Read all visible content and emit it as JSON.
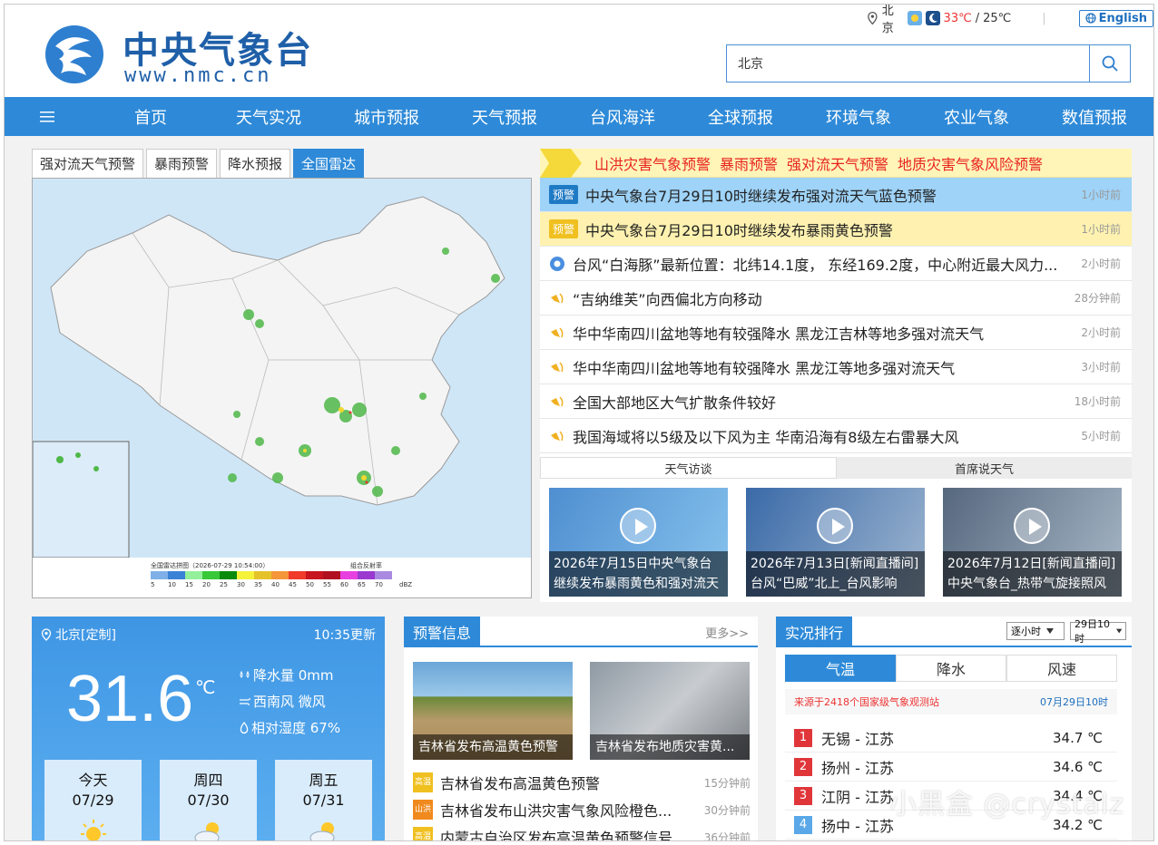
{
  "header": {
    "logo_cn": "中央气象台",
    "logo_en": "www.nmc.cn",
    "city": "北京",
    "temp_high": "33℃",
    "temp_sep": " / ",
    "temp_low": "25℃",
    "english_label": "English",
    "search_value": "北京"
  },
  "nav": {
    "items": [
      "首页",
      "天气实况",
      "城市预报",
      "天气预报",
      "台风海洋",
      "全球预报",
      "环境气象",
      "农业气象",
      "数值预报"
    ]
  },
  "radar": {
    "tabs": [
      "强对流天气预警",
      "暴雨预警",
      "降水预报",
      "全国雷达"
    ],
    "active_tab": 3,
    "legend_title": "全国雷达拼图（2026-07-29 10:54:00）",
    "legend_unit_label": "组合反射率",
    "legend_values": [
      "5",
      "10",
      "15",
      "20",
      "25",
      "30",
      "35",
      "40",
      "45",
      "50",
      "55",
      "60",
      "65",
      "70"
    ],
    "legend_unit": "dBZ",
    "legend_colors": [
      "#7fb0e8",
      "#3a82d6",
      "#94f09a",
      "#38c838",
      "#0a8a0a",
      "#f5f23a",
      "#e6c22a",
      "#f5963a",
      "#f03a2a",
      "#c8141e",
      "#b01020",
      "#e840e0",
      "#9a38d0",
      "#a88ae0"
    ]
  },
  "warnings": {
    "banner": [
      "山洪灾害气象预警",
      "暴雨预警",
      "强对流天气预警",
      "地质灾害气象风险预警"
    ],
    "items": [
      {
        "badge": "预警",
        "text": "中央气象台7月29日10时继续发布强对流天气蓝色预警",
        "time": "1小时前",
        "style": "blue"
      },
      {
        "badge": "预警",
        "text": "中央气象台7月29日10时继续发布暴雨黄色预警",
        "time": "1小时前",
        "style": "yellow"
      },
      {
        "icon": "typhoon-icon",
        "text": "台风“白海豚”最新位置：北纬14.1度， 东经169.2度，中心附近最大风力...",
        "time": "2小时前"
      },
      {
        "icon": "speaker-icon",
        "text": "“吉纳维芙”向西偏北方向移动",
        "time": "28分钟前"
      },
      {
        "icon": "speaker-icon",
        "text": "华中华南四川盆地等地有较强降水 黑龙江吉林等地多强对流天气",
        "time": "2小时前"
      },
      {
        "icon": "speaker-icon",
        "text": "华中华南四川盆地等地有较强降水 黑龙江等地多强对流天气",
        "time": "3小时前"
      },
      {
        "icon": "speaker-icon",
        "text": "全国大部地区大气扩散条件较好",
        "time": "18小时前"
      },
      {
        "icon": "speaker-icon",
        "text": "我国海域将以5级及以下风为主 华南沿海有8级左右雷暴大风",
        "time": "5小时前"
      }
    ],
    "sub_tabs": [
      "天气访谈",
      "首席说天气"
    ],
    "videos": [
      {
        "caption": "2026年7月15日中央气象台继续发布暴雨黄色和强对流天气"
      },
      {
        "caption": "2026年7月13日[新闻直播间]台风“巴威”北上_台风影响"
      },
      {
        "caption": "2026年7月12日[新闻直播间]中央气象台_热带气旋接照风"
      }
    ]
  },
  "current": {
    "location": "北京[定制]",
    "updated": "10:35更新",
    "temp": "31.6",
    "unit": "℃",
    "precip": "降水量 0mm",
    "wind": "西南风 微风",
    "humidity": "相对湿度 67%",
    "days": [
      {
        "name": "今天",
        "date": "07/29"
      },
      {
        "name": "周四",
        "date": "07/30"
      },
      {
        "name": "周五",
        "date": "07/31"
      }
    ]
  },
  "alerts": {
    "title": "预警信息",
    "more": "更多>>",
    "images": [
      {
        "caption": "吉林省发布高温黄色预警"
      },
      {
        "caption": "吉林省发布地质灾害黄..."
      }
    ],
    "items": [
      {
        "icon_text": "高温",
        "text": "吉林省发布高温黄色预警",
        "time": "15分钟前",
        "color": "#f0c020"
      },
      {
        "icon_text": "山洪",
        "text": "吉林省发布山洪灾害气象风险橙色...",
        "time": "30分钟前",
        "color": "#f08a1e"
      },
      {
        "icon_text": "高温",
        "text": "内蒙古自治区发布高温黄色预警信号",
        "time": "36分钟前",
        "color": "#f0c020"
      }
    ]
  },
  "ranking": {
    "title": "实况排行",
    "interval": "逐小时",
    "time_sel": "29日10时",
    "tabs": [
      "气温",
      "降水",
      "风速"
    ],
    "source": "来源于2418个国家级气象观测站",
    "date": "07月29日10时",
    "rows": [
      {
        "rank": "1",
        "name": "无锡 - 江苏",
        "value": "34.7 ℃",
        "color": "#e0363a"
      },
      {
        "rank": "2",
        "name": "扬州 - 江苏",
        "value": "34.6 ℃",
        "color": "#e0363a"
      },
      {
        "rank": "3",
        "name": "江阴 - 江苏",
        "value": "34.4 ℃",
        "color": "#e0363a"
      },
      {
        "rank": "4",
        "name": "扬中 - 江苏",
        "value": "34.2 ℃",
        "color": "#5aa8e8"
      }
    ]
  },
  "watermark": "小黑盒 @crystalz"
}
